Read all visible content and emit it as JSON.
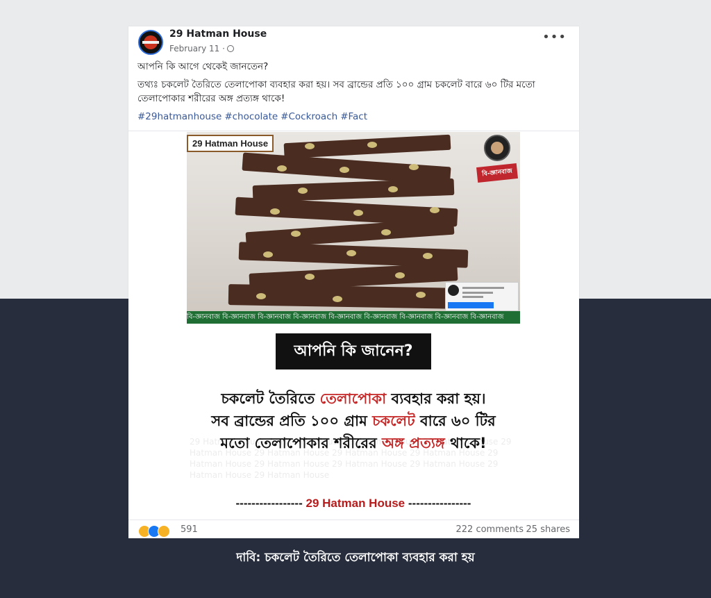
{
  "post": {
    "page_name": "29 Hatman House",
    "date": "February 11 ·",
    "line1": "আপনি কি আগে থেকেই জানতেন?",
    "line2": "তথ্যঃ চকলেট তৈরিতে তেলাপোকা ব্যবহার করা হয়। সব ব্রান্ডের প্রতি ১০০ গ্রাম চকলেট বারে ৬০ টির মতো তেলাপোকার শরীরের অঙ্গ প্রত্যঙ্গ থাকে!",
    "hashtags": [
      "#29hatmanhouse",
      "#chocolate",
      "#Cockroach",
      "#Fact"
    ],
    "more_label": "•••"
  },
  "image": {
    "brand_tag": "29 Hatman House",
    "logo_label": "বি-জ্ঞানবাজ",
    "strip_text": "বি-জ্ঞানবাজ বি-জ্ঞানবাজ বি-জ্ঞানবাজ বি-জ্ঞানবাজ বি-জ্ঞানবাজ বি-জ্ঞানবাজ বি-জ্ঞানবাজ বি-জ্ঞানবাজ বি-জ্ঞানবাজ",
    "question": "আপনি কি জানেন?",
    "claim_part1": "চকলেট তৈরিতে ",
    "claim_red1": "তেলাপোকা",
    "claim_part2": " ব্যবহার করা হয়। সব ব্রান্ডের প্রতি ১০০ গ্রাম ",
    "claim_red2": "চকলেট",
    "claim_part3": " বারে ৬০ টির মতো তেলাপোকার শরীরের ",
    "claim_red3": "অঙ্গ প্রত্যঙ্গ",
    "claim_part4": " থাকে!",
    "watermark": "29 Hatman House 29 Hatman House 29 Hatman House 29 Hatman House 29 Hatman House 29 Hatman House 29 Hatman House 29 Hatman House 29 Hatman House 29 Hatman House 29 Hatman House 29 Hatman House 29 Hatman House 29 Hatman House",
    "footer_dashes_left": "----------------- ",
    "footer_brand": "29 Hatman House",
    "footer_dashes_right": " ----------------"
  },
  "engagement": {
    "reactions": "591",
    "comments": "222 comments",
    "shares": "25 shares"
  },
  "caption": "দাবি: চকলেট তৈরিতে তেলাপোকা ব্যবহার করা হয়"
}
